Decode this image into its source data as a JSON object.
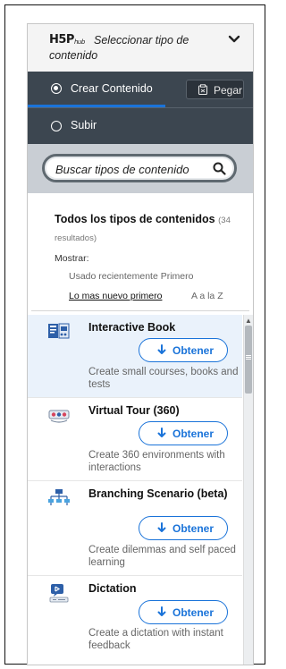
{
  "header": {
    "logo_text": "H5P",
    "logo_sub": "hub",
    "title": "Seleccionar tipo de contenido",
    "toggle_icon": "chevron-down-icon"
  },
  "tabs": {
    "create_label": "Crear Contenido",
    "upload_label": "Subir",
    "selected": "create",
    "paste_label": "Pegar"
  },
  "search": {
    "placeholder": "Buscar tipos de contenido",
    "value": ""
  },
  "filters": {
    "all_title": "Todos los tipos de contenidos",
    "all_count": "(34 resultados)",
    "show_label": "Mostrar:",
    "sort_options": [
      "Usado recientemente Primero",
      "Lo mas nuevo primero",
      "A a la Z"
    ],
    "active_sort": "Lo mas nuevo primero"
  },
  "content_types": [
    {
      "title": "Interactive Book",
      "button": "Obtener",
      "description": "Create small courses, books and tests",
      "icon": "interactive-book-icon"
    },
    {
      "title": "Virtual Tour (360)",
      "button": "Obtener",
      "description": "Create 360 environments with interactions",
      "icon": "virtual-tour-icon"
    },
    {
      "title": "Branching Scenario (beta)",
      "button": "Obtener",
      "description": "Create dilemmas and self paced learning",
      "icon": "branching-scenario-icon"
    },
    {
      "title": "Dictation",
      "button": "Obtener",
      "description": "Create a dictation with instant feedback",
      "icon": "dictation-icon"
    }
  ],
  "colors": {
    "accent": "#1a73d9",
    "panel": "#3c4650",
    "search_bg": "#c9ced4",
    "active_item": "#eaf2fb"
  }
}
